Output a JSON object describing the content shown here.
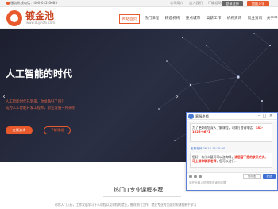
{
  "topbar": {
    "hotline": "服务热线电话：400-012-6683",
    "links": [
      "公司简介",
      "加入我们",
      "IT编程网"
    ],
    "login": "登录注册",
    "join": "加盟入学"
  },
  "header": {
    "logo_name": "镀金池",
    "logo_domain": "www.dujinchi.com",
    "nav": [
      "网站首页",
      "热门课程",
      "精选机构",
      "重点城市",
      "高薪工作",
      "机构资讯",
      "就业资讯",
      "关于平台"
    ]
  },
  "hero": {
    "title": "人工智能的时代",
    "sub1": "人工智能时代已到来，你准备好了吗？",
    "sub2": "成为人工智能开发工程师，职业发展一片光明",
    "btn1": "在线咨询",
    "btn2": "了解课程"
  },
  "section": {
    "title": "热门IT专业课程推荐",
    "desc": "帮你入门入行，工作发展学习什么课程以及课程的就业，推荐热门工作，就业专业的全面对照课程新手学习"
  },
  "chat": {
    "agent": "客服老师",
    "greeting": "为了更好帮您深入了解课程，可拨打咨询电话：",
    "phone": "182-1026-9671",
    "meta": "客服老师  08-14 15:29:30",
    "reply_a": "您好，有什么疑问可以咨询哦，",
    "reply_hl": "请您留下您的联系方式，马上帮你联系老师",
    "reply_b": "，您可以进行...",
    "placeholder": "请在此输入您想要咨询的问题",
    "quick": "常用语",
    "send": "发送"
  },
  "colors": {
    "brand": "#e8592c",
    "hero_bg": "#1c1f2e",
    "chat_accent": "#3d6fd4"
  }
}
